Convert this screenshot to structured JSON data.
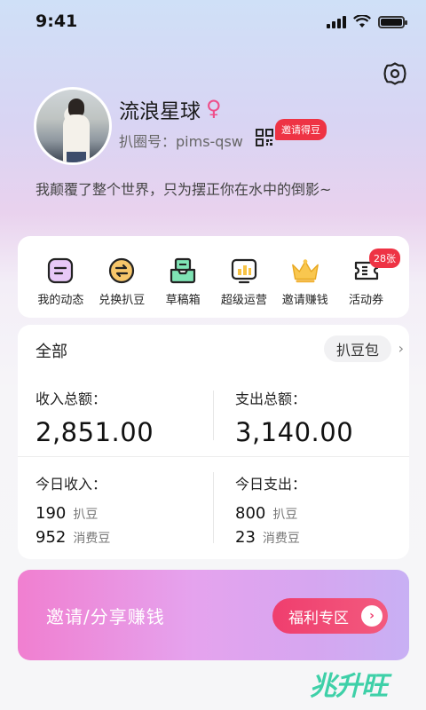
{
  "status_bar": {
    "time": "9:41"
  },
  "profile": {
    "name": "流浪星球",
    "gender_symbol": "♀",
    "id_line": "扒圈号：pims-qsw",
    "invite_badge": "邀请得豆",
    "bio": "我颠覆了整个世界，只为摆正你在水中的倒影~"
  },
  "menu": {
    "items": [
      {
        "label": "我的动态",
        "icon": "post-icon"
      },
      {
        "label": "兑换扒豆",
        "icon": "exchange-icon"
      },
      {
        "label": "草稿箱",
        "icon": "draft-box-icon"
      },
      {
        "label": "超级运营",
        "icon": "chart-icon"
      },
      {
        "label": "邀请赚钱",
        "icon": "crown-icon"
      },
      {
        "label": "活动券",
        "icon": "ticket-icon"
      }
    ],
    "coupon_badge": "28张"
  },
  "stats": {
    "all_label": "全部",
    "pack_label": "扒豆包",
    "income_total_label": "收入总额：",
    "income_total": "2,851.00",
    "expense_total_label": "支出总额：",
    "expense_total": "3,140.00",
    "today_income_label": "今日收入：",
    "today_expense_label": "今日支出：",
    "today_income": [
      {
        "value": "190",
        "unit": "扒豆"
      },
      {
        "value": "952",
        "unit": "消费豆"
      }
    ],
    "today_expense": [
      {
        "value": "800",
        "unit": "扒豆"
      },
      {
        "value": "23",
        "unit": "消费豆"
      }
    ]
  },
  "banner": {
    "text": "邀请/分享赚钱",
    "button": "福利专区"
  },
  "watermark": "兆升旺"
}
